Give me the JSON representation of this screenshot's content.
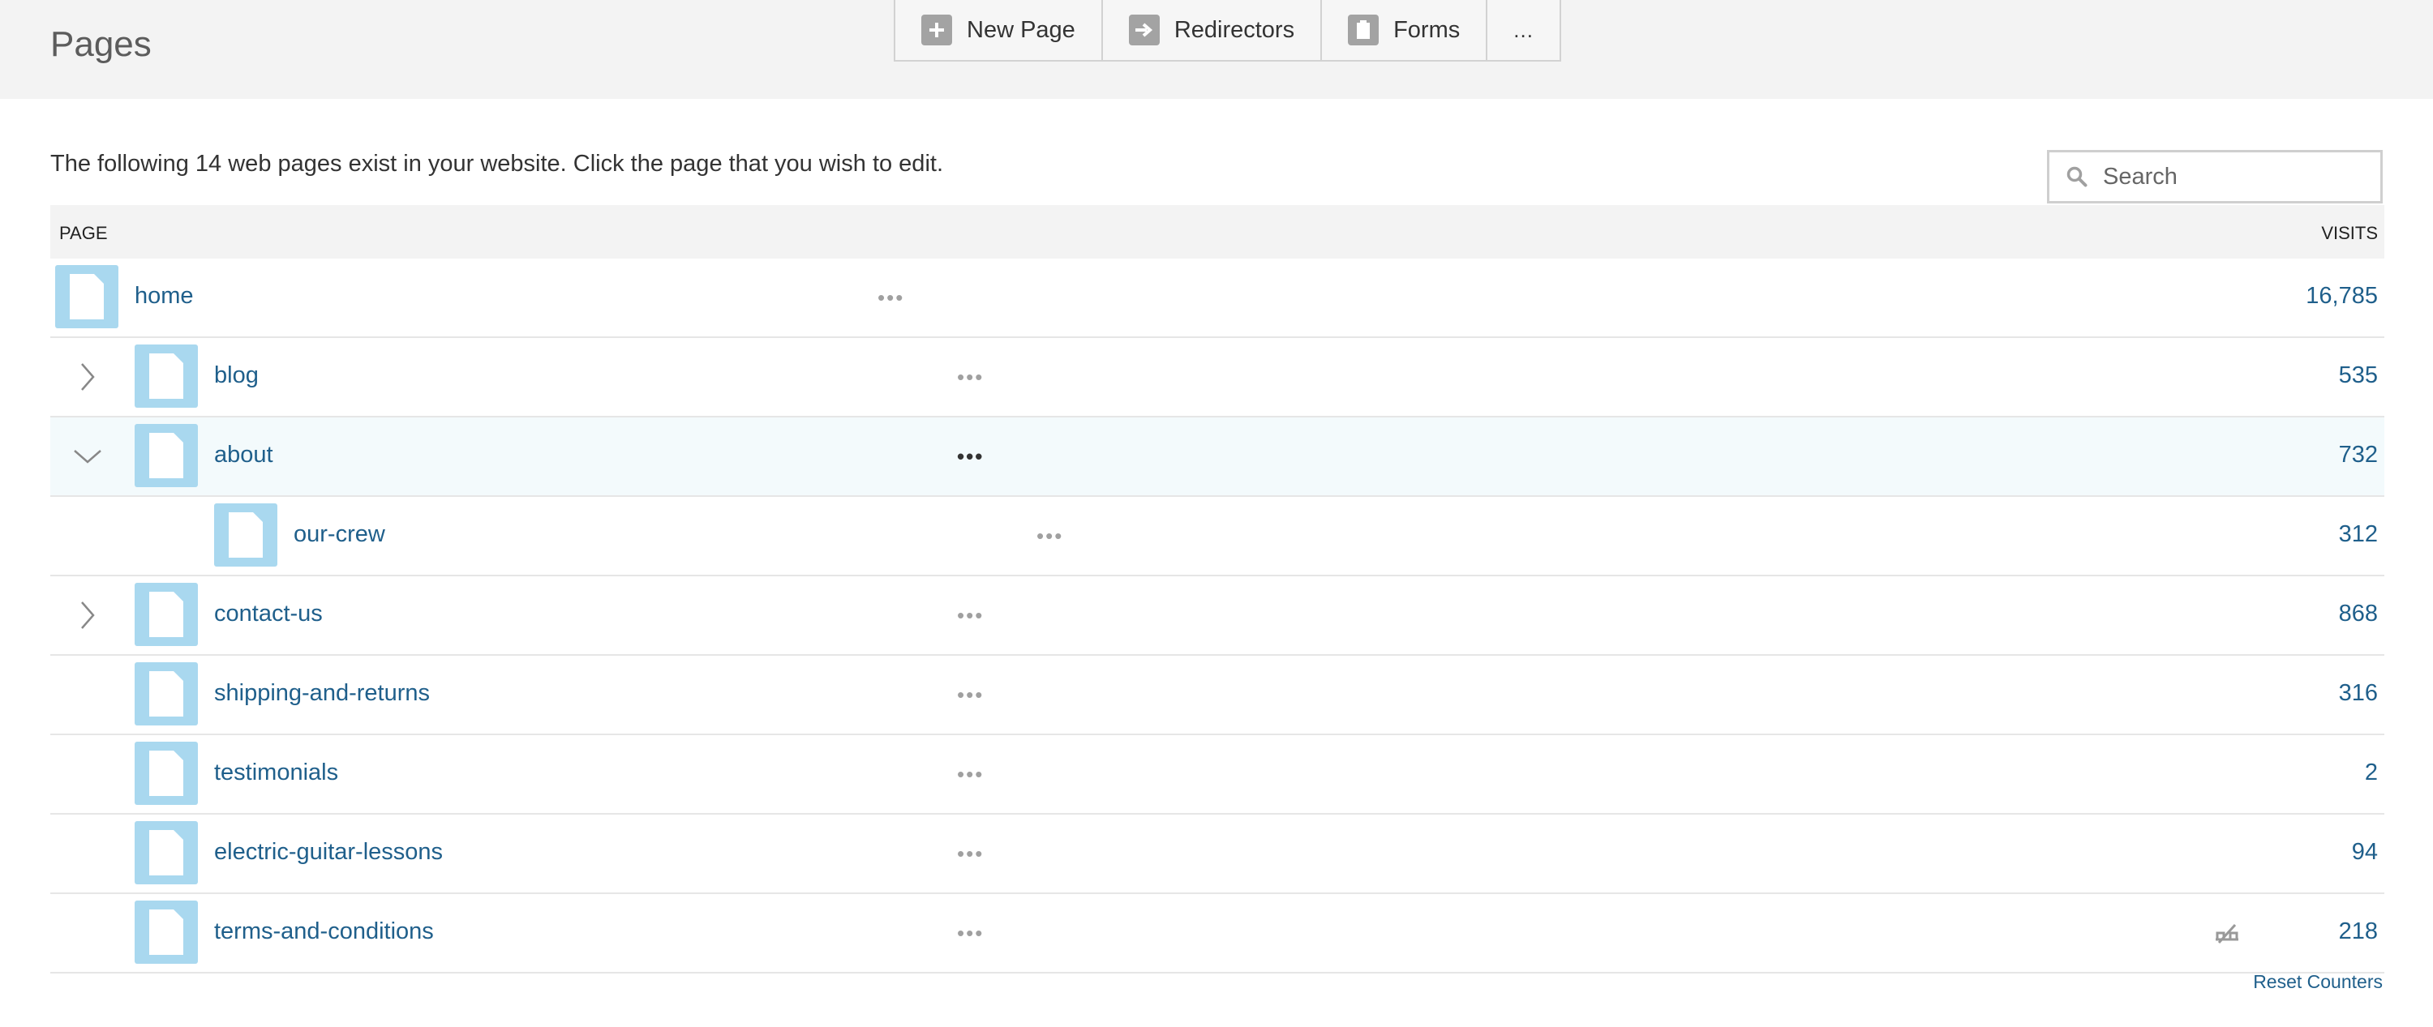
{
  "header": {
    "title": "Pages",
    "toolbar": {
      "new_page": "New Page",
      "redirectors": "Redirectors",
      "forms": "Forms",
      "more": "..."
    }
  },
  "intro_text": "The following 14 web pages exist in your website. Click the page that you wish to edit.",
  "search": {
    "placeholder": "Search"
  },
  "table": {
    "col_page": "PAGE",
    "col_visits": "VISITS",
    "rows": [
      {
        "name": "home",
        "visits": "16,785",
        "level": 0,
        "toggle": "none"
      },
      {
        "name": "blog",
        "visits": "535",
        "level": 1,
        "toggle": "collapsed"
      },
      {
        "name": "about",
        "visits": "732",
        "level": 1,
        "toggle": "expanded"
      },
      {
        "name": "our-crew",
        "visits": "312",
        "level": 2,
        "toggle": "none"
      },
      {
        "name": "contact-us",
        "visits": "868",
        "level": 1,
        "toggle": "collapsed"
      },
      {
        "name": "shipping-and-returns",
        "visits": "316",
        "level": 1,
        "toggle": "none"
      },
      {
        "name": "testimonials",
        "visits": "2",
        "level": 1,
        "toggle": "none"
      },
      {
        "name": "electric-guitar-lessons",
        "visits": "94",
        "level": 1,
        "toggle": "none"
      },
      {
        "name": "terms-and-conditions",
        "visits": "218",
        "level": 1,
        "toggle": "none",
        "hidden_from_nav": true
      }
    ]
  },
  "reset_counters": "Reset Counters",
  "colors": {
    "link": "#1f5f8b",
    "page_icon": "#a9d8ef",
    "header_bg": "#f3f3f3"
  }
}
